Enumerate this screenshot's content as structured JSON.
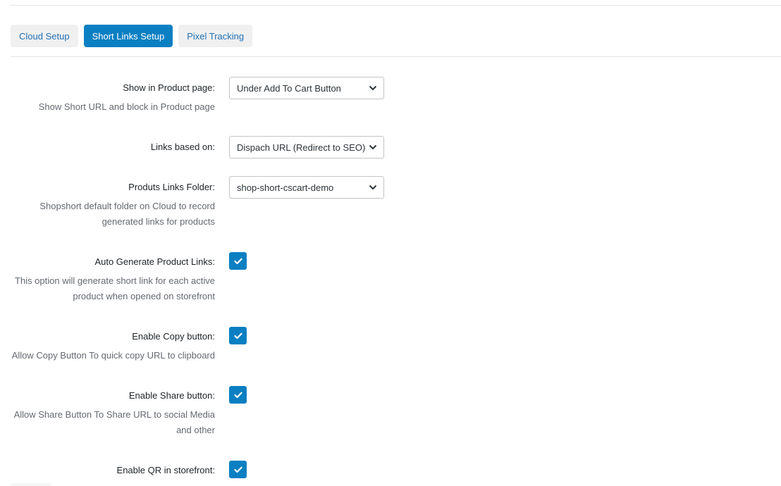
{
  "tabs": [
    {
      "label": "Cloud Setup",
      "active": false
    },
    {
      "label": "Short Links Setup",
      "active": true
    },
    {
      "label": "Pixel Tracking",
      "active": false
    }
  ],
  "settings": {
    "show_in_product_page": {
      "label": "Show in Product page:",
      "description": "Show Short URL and block in Product page",
      "value": "Under Add To Cart Button"
    },
    "links_based_on": {
      "label": "Links based on:",
      "value": "Dispach URL (Redirect to SEO)"
    },
    "products_links_folder": {
      "label": "Produts Links Folder:",
      "description_line1": "Shopshort default folder on Cloud to record",
      "description_line2": "generated links for products",
      "value": "shop-short-cscart-demo"
    },
    "auto_generate": {
      "label": "Auto Generate Product Links:",
      "description_line1": "This option will generate short link for each active",
      "description_line2": "product when opened on storefront",
      "checked": true
    },
    "enable_copy": {
      "label": "Enable Copy button:",
      "description": "Allow Copy Button To quick copy URL to clipboard",
      "checked": true
    },
    "enable_share": {
      "label": "Enable Share button:",
      "description_line1": "Allow Share Button To Share URL to social Media",
      "description_line2": "and other",
      "checked": true
    },
    "enable_qr": {
      "label": "Enable QR in storefront:",
      "checked": true
    }
  },
  "colors": {
    "accent": "#0a7fc2",
    "link": "#2271b1",
    "tab_bg": "#f0f0f1",
    "muted_text": "#646970"
  },
  "icons": {
    "checkbox": "check-icon",
    "select": "chevron-down-icon"
  }
}
